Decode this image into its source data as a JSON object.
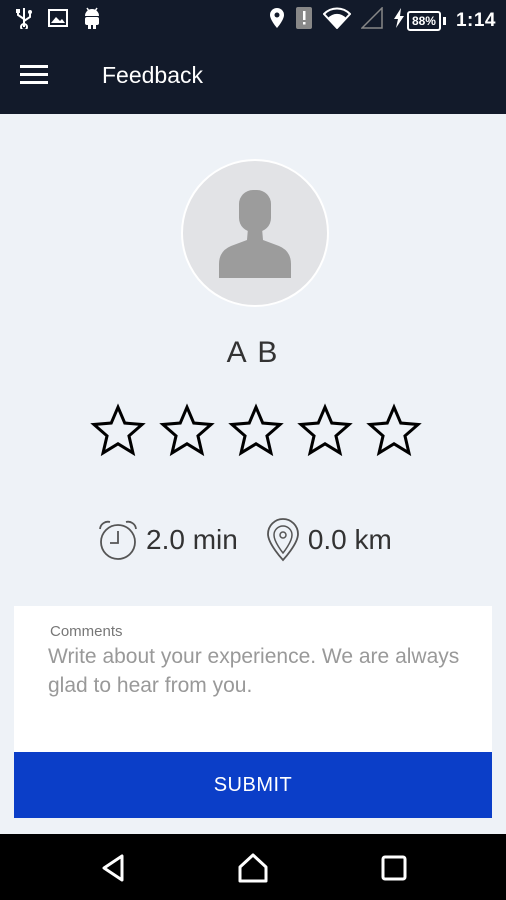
{
  "status_bar": {
    "time": "1:14",
    "battery": "88%",
    "icons": [
      "usb-icon",
      "image-icon",
      "android-icon",
      "location-icon",
      "alert-icon",
      "wifi-icon",
      "signal-icon",
      "charging-icon",
      "battery-icon"
    ]
  },
  "app_bar": {
    "title": "Feedback",
    "menu_icon": "hamburger-menu-icon"
  },
  "profile": {
    "name": "A B",
    "avatar_icon": "person-placeholder-icon"
  },
  "rating": {
    "max": 5,
    "value": 0
  },
  "trip_stats": {
    "duration": "2.0 min",
    "distance": "0.0 km",
    "duration_icon": "alarm-clock-icon",
    "distance_icon": "location-pin-icon"
  },
  "comments": {
    "label": "Comments",
    "value": "",
    "placeholder": "Write about your experience. We are always glad to hear from you."
  },
  "submit": {
    "label": "SUBMIT"
  },
  "nav_bar": {
    "icons": [
      "back-icon",
      "home-icon",
      "recents-icon"
    ]
  },
  "colors": {
    "header": "#121a2a",
    "background": "#eef2f7",
    "accent": "#0b3ec8"
  }
}
